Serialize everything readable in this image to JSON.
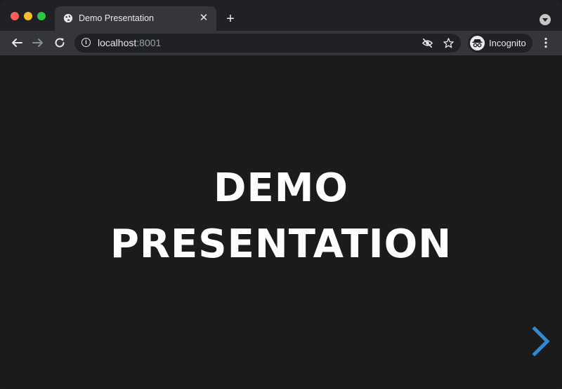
{
  "browser": {
    "tab": {
      "title": "Demo Presentation",
      "close_glyph": "✕",
      "favicon": "globe-icon"
    },
    "new_tab_glyph": "+",
    "address": {
      "host": "localhost",
      "port": ":8001",
      "info_glyph": "i"
    },
    "profile": {
      "label": "Incognito"
    }
  },
  "slide": {
    "title_line1": "DEMO",
    "title_line2": "PRESENTATION"
  },
  "colors": {
    "accent": "#2f8bd3",
    "background": "#1b1b1b",
    "title": "#ffffff"
  }
}
